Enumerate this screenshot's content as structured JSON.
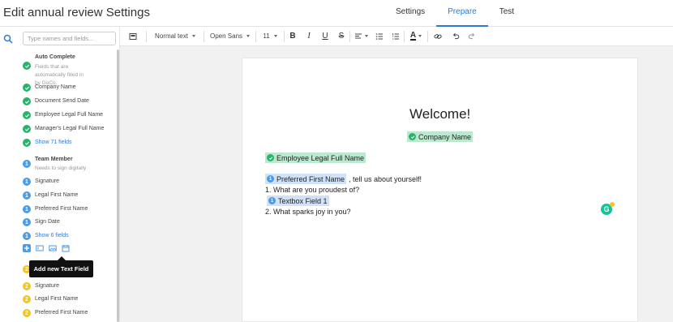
{
  "header": {
    "title": "Edit annual review Settings",
    "tabs": [
      {
        "label": "Settings",
        "active": false
      },
      {
        "label": "Prepare",
        "active": true
      },
      {
        "label": "Test",
        "active": false
      }
    ]
  },
  "sidebar": {
    "search": {
      "placeholder": "Type names and fields..."
    },
    "auto_complete": {
      "title": "Auto Complete",
      "subtitle": "Fields that are automatically filled in by GoCo.",
      "items": [
        "Company Name",
        "Document Send Date",
        "Employee Legal Full Name",
        "Manager's Legal Full Name"
      ],
      "show_link": "Show 71 fields"
    },
    "team_member": {
      "title": "Team Member",
      "subtitle": "Needs to sign digitally",
      "items": [
        "Signature",
        "Legal First Name",
        "Preferred First Name",
        "Sign Date"
      ],
      "show_link": "Show 6 fields"
    },
    "tooltip": "Add new Text Field",
    "third_group": {
      "items": [
        "Signature",
        "Legal First Name",
        "Preferred First Name"
      ]
    }
  },
  "toolbar": {
    "style_select": "Normal text",
    "font_select": "Open Sans",
    "size_select": "11",
    "bold": "B",
    "italic": "I",
    "underline": "U",
    "strike": "S",
    "font_color": "A"
  },
  "document": {
    "heading": "Welcome!",
    "company_chip": "Company Name",
    "employee_chip": "Employee Legal Full Name",
    "preferred_chip": "Preferred First Name",
    "intro_tail": ", tell us about yourself!",
    "q1": "1. What are you proudest of?",
    "textbox_chip": "Textbox Field 1",
    "q2": "2. What sparks joy in you?"
  },
  "colors": {
    "accent": "#2d7ad6",
    "green": "#27b36a",
    "blue": "#4d9be3",
    "yellow": "#f0c520"
  },
  "badges": {
    "team_member_number": "1",
    "third_group_number": "2"
  }
}
